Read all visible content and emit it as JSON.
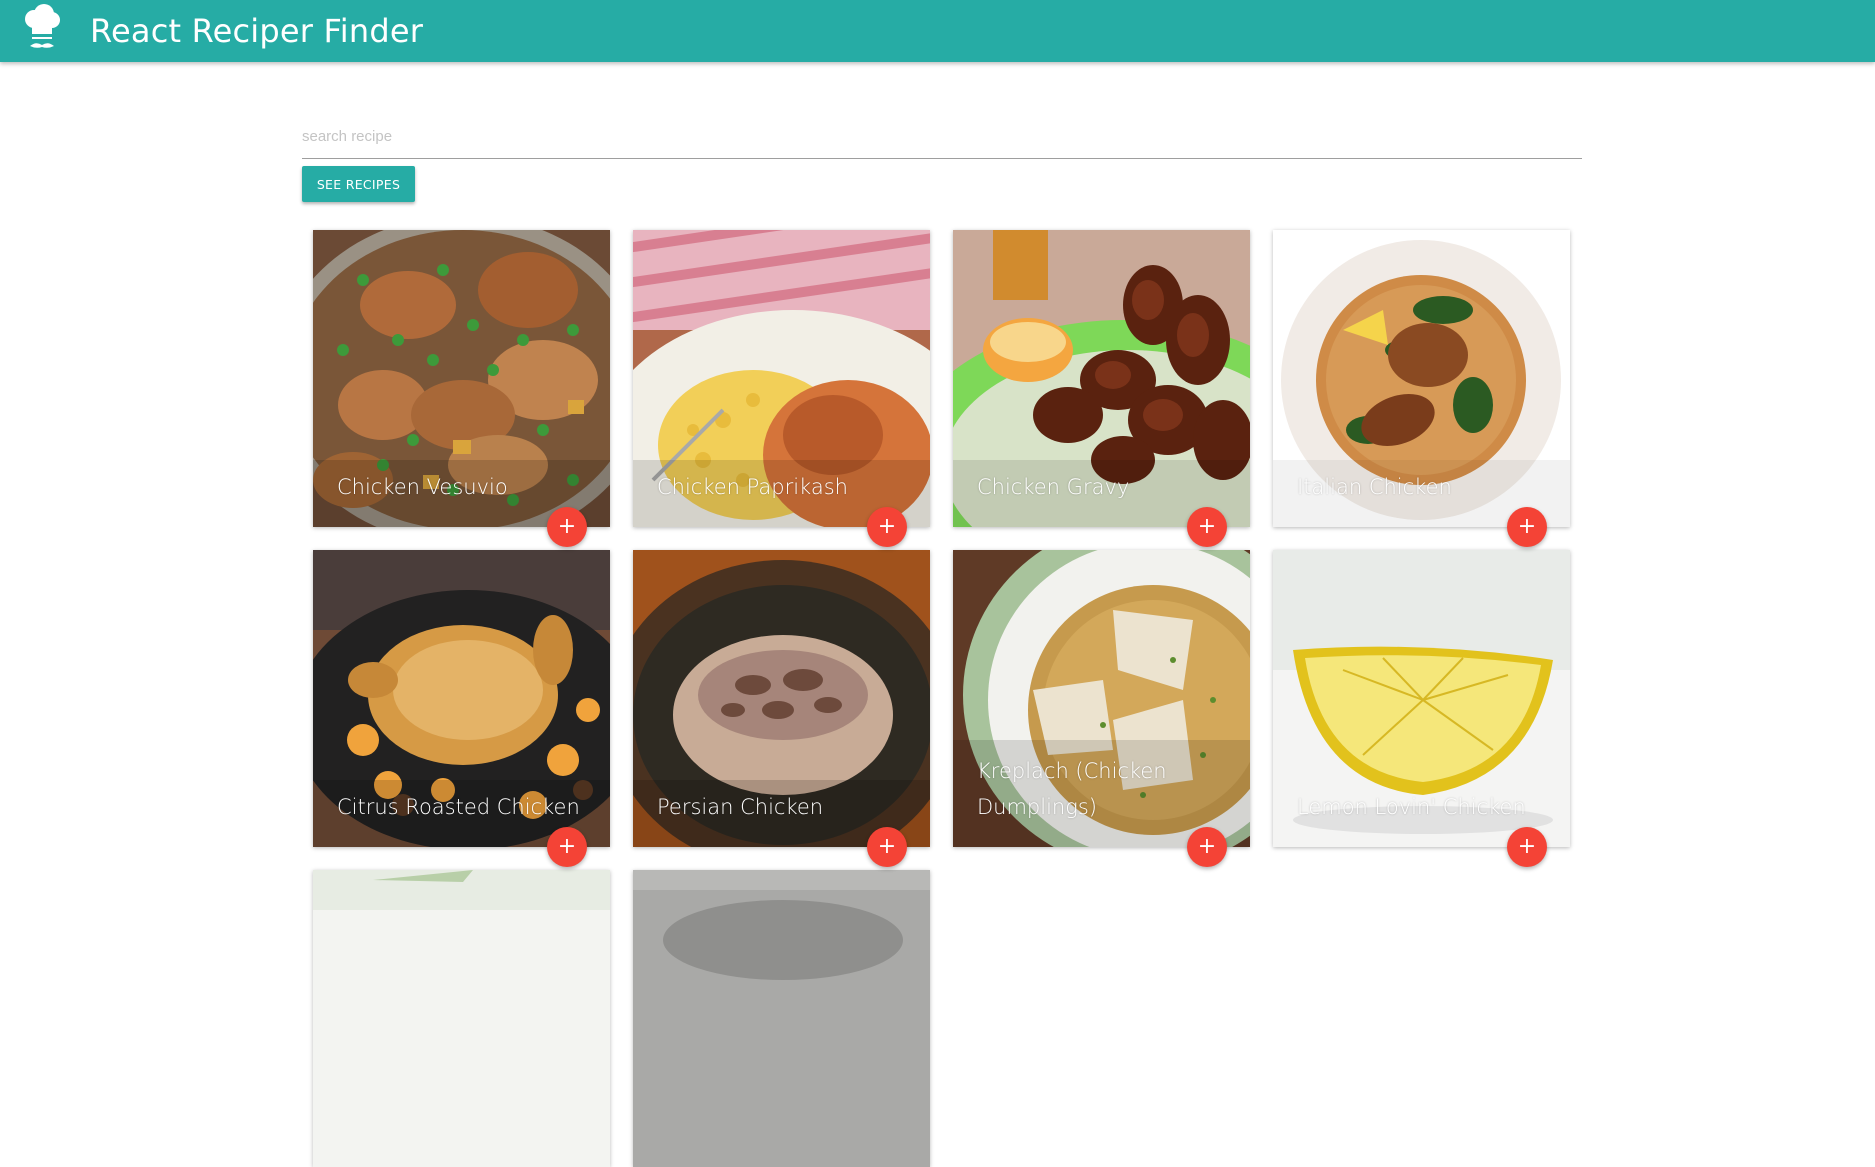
{
  "app": {
    "title": "React Reciper Finder",
    "logo_icon": "chef-hat-icon",
    "brand_color": "#26aca5",
    "accent_color": "#f44336"
  },
  "search": {
    "placeholder": "search recipe",
    "value": ""
  },
  "actions": {
    "see_recipes_label": "SEE RECIPES",
    "add_label": "+"
  },
  "recipes": [
    {
      "title": "Chicken Vesuvio",
      "image": "skillet-chicken-peas"
    },
    {
      "title": "Chicken Paprikash",
      "image": "paprikash-plate"
    },
    {
      "title": "Chicken Gravy",
      "image": "fried-chicken-plate"
    },
    {
      "title": "Italian Chicken",
      "image": "chicken-bowl-greens"
    },
    {
      "title": "Citrus Roasted Chicken",
      "image": "roast-chicken-oranges"
    },
    {
      "title": "Persian Chicken",
      "image": "chicken-rice-plate"
    },
    {
      "title": "Kreplach (Chicken Dumplings)",
      "image": "dumpling-soup-bowl"
    },
    {
      "title": "Lemon Lovin' Chicken",
      "image": "lemon-wedge"
    },
    {
      "title": "",
      "image": "partial-card"
    },
    {
      "title": "",
      "image": "partial-card"
    }
  ]
}
